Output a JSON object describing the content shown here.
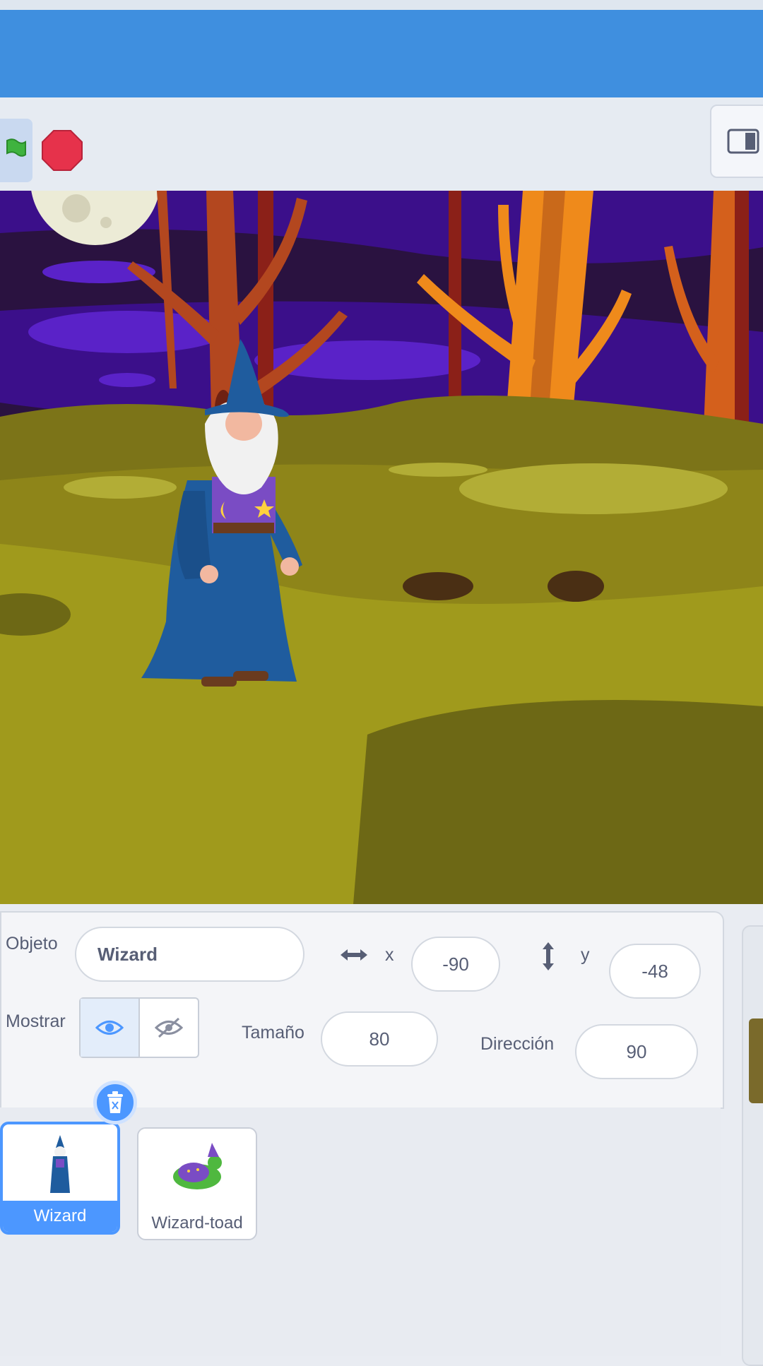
{
  "colors": {
    "menu_blue": "#3f8fdf",
    "accent_blue": "#4c97ff",
    "stop_red": "#e6324b",
    "flag_green": "#3fb33f",
    "text_gray": "#575e75"
  },
  "stage_controls": {
    "green_flag_icon": "green-flag-icon",
    "stop_icon": "stop-sign-icon",
    "layout_icon": "small-stage-icon"
  },
  "sprite_info": {
    "sprite_label": "Objeto",
    "sprite_name": "Wizard",
    "x_label": "x",
    "x_value": "-90",
    "y_label": "y",
    "y_value": "-48",
    "show_label": "Mostrar",
    "size_label": "Tamaño",
    "size_value": "80",
    "direction_label": "Dirección",
    "direction_value": "90"
  },
  "sprites": [
    {
      "name": "Wizard",
      "selected": true
    },
    {
      "name": "Wizard-toad",
      "selected": false
    }
  ]
}
